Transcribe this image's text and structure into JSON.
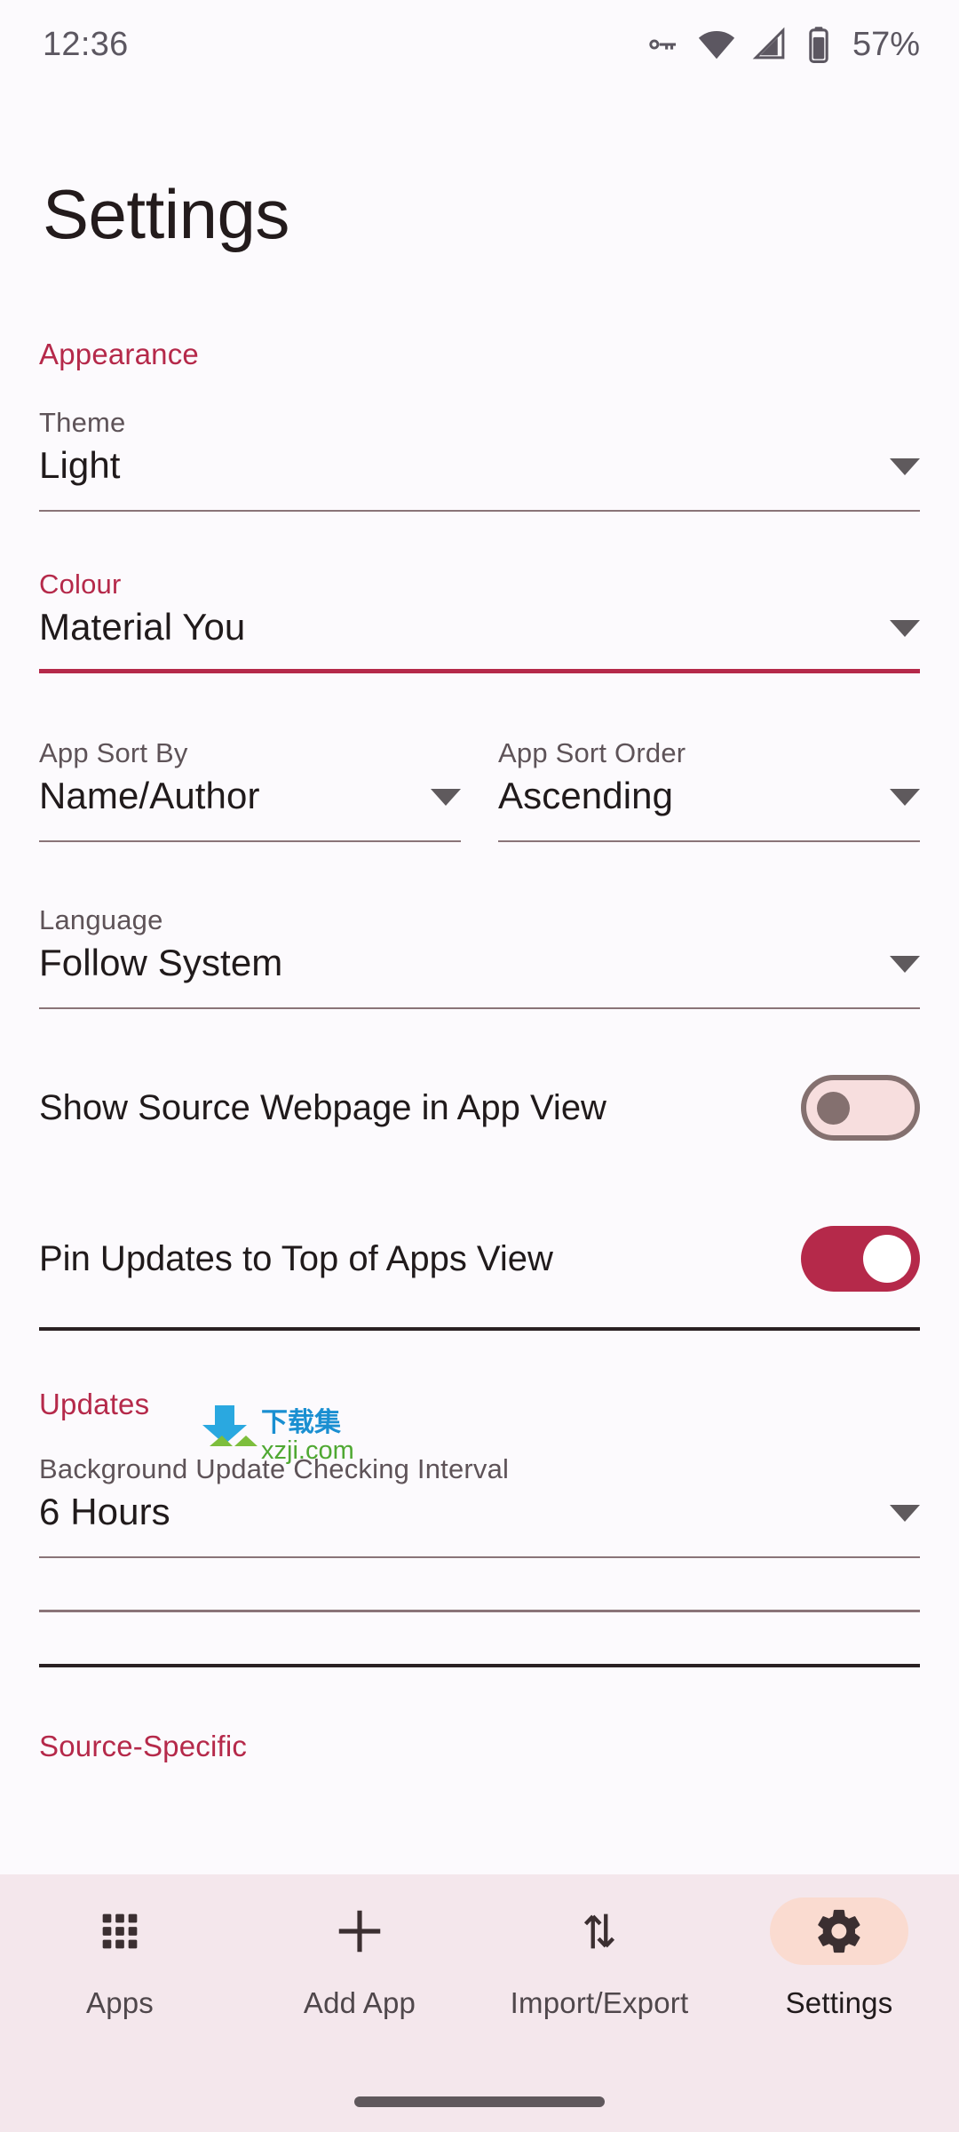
{
  "status_bar": {
    "time": "12:36",
    "battery_percent": "57%",
    "icons": [
      "vpn-key-icon",
      "wifi-icon",
      "cellular-signal-icon",
      "battery-icon"
    ]
  },
  "header": {
    "title": "Settings"
  },
  "sections": {
    "appearance": {
      "heading": "Appearance",
      "theme": {
        "label": "Theme",
        "value": "Light"
      },
      "colour": {
        "label": "Colour",
        "value": "Material You"
      },
      "sort_by": {
        "label": "App Sort By",
        "value": "Name/Author"
      },
      "sort_order": {
        "label": "App Sort Order",
        "value": "Ascending"
      },
      "language": {
        "label": "Language",
        "value": "Follow System"
      },
      "show_source_webpage": {
        "label": "Show Source Webpage in App View",
        "state": "off"
      },
      "pin_updates": {
        "label": "Pin Updates to Top of Apps View",
        "state": "on"
      }
    },
    "updates": {
      "heading": "Updates",
      "interval": {
        "label": "Background Update Checking Interval",
        "value": "6 Hours"
      }
    },
    "source_specific": {
      "heading": "Source-Specific"
    }
  },
  "watermark": {
    "cn_text": "下载集",
    "url_text": "xzji.com"
  },
  "bottom_nav": {
    "items": [
      {
        "label": "Apps",
        "icon": "grid-icon",
        "active": false
      },
      {
        "label": "Add App",
        "icon": "plus-icon",
        "active": false
      },
      {
        "label": "Import/Export",
        "icon": "import-export-arrows-icon",
        "active": false
      },
      {
        "label": "Settings",
        "icon": "gear-icon",
        "active": true
      }
    ]
  },
  "colors": {
    "accent": "#B5294A",
    "background": "#FCFAFD",
    "nav_background": "#F4E7EC",
    "active_pill": "#FADBD0",
    "text_primary": "#201A1B",
    "text_secondary": "#5E5358",
    "switch_off_track": "#F7DEDE",
    "switch_off_thumb": "#84706F"
  }
}
